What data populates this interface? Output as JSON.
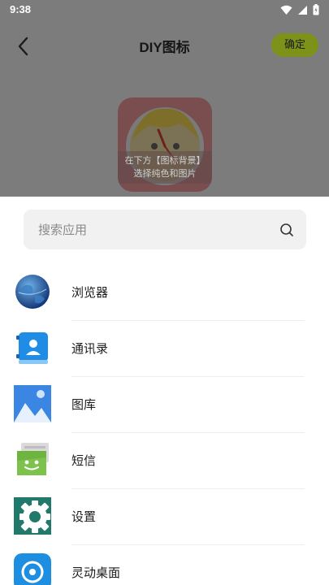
{
  "status_bar": {
    "time": "9:38"
  },
  "header": {
    "title": "DIY图标",
    "confirm_label": "确定"
  },
  "preview": {
    "hint_line1": "在下方【图标背景】",
    "hint_line2": "选择纯色和图片"
  },
  "search": {
    "placeholder": "搜索应用"
  },
  "apps": [
    {
      "label": "浏览器",
      "icon": "browser-globe-icon"
    },
    {
      "label": "通讯录",
      "icon": "contacts-icon"
    },
    {
      "label": "图库",
      "icon": "gallery-icon"
    },
    {
      "label": "短信",
      "icon": "messages-icon"
    },
    {
      "label": "设置",
      "icon": "settings-gear-icon"
    },
    {
      "label": "灵动桌面",
      "icon": "desktop-launcher-icon"
    }
  ],
  "colors": {
    "accent": "#7d9219",
    "backdrop": "#7c7c7c",
    "search_bg": "#f1f1f1"
  }
}
